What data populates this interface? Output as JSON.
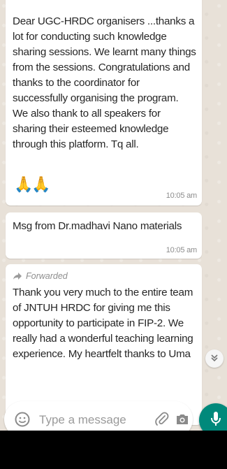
{
  "messages": [
    {
      "text": "Dear UGC-HRDC organisers ...thanks a lot for conducting such knowledge sharing sessions. We learnt many things from the sessions. Congratulations and thanks to the coordinator for successfully organising the program. We also thank to all speakers for sharing their esteemed knowledge through this platform. Tq all.",
      "emoji": "🙏🙏",
      "time": "10:05 am"
    },
    {
      "text": "Msg from Dr.madhavi Nano materials",
      "time": "10:05 am"
    },
    {
      "forwarded_label": "Forwarded",
      "text": "Thank you very much to the entire team of JNTUH HRDC for giving me this opportunity to participate in FIP-2.  We really had a wonderful teaching learning experience. My heartfelt thanks to Uma"
    }
  ],
  "composer": {
    "placeholder": "Type a message"
  },
  "icons": [
    "emoji-icon",
    "paperclip-icon",
    "camera-icon",
    "mic-icon",
    "double-chevron-down-icon",
    "forward-arrow-icon"
  ]
}
